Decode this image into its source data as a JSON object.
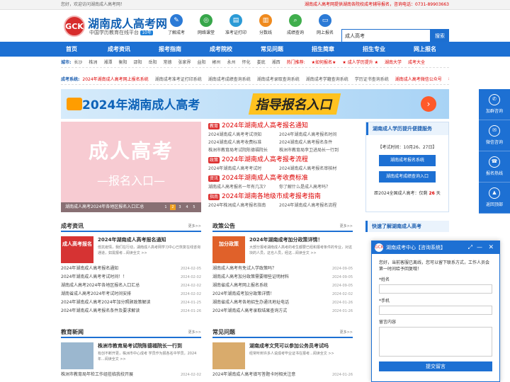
{
  "topbar": {
    "welcome": "您好，欢迎访问湖南成人高考网！",
    "notice": "湖南成人高考网提供湖南各院校成考辅导报名，咨询电话：0731-89903663"
  },
  "logo": {
    "mark": "GCK",
    "title": "湖南成人高考网",
    "subtitle": "中国学历教育在线平台",
    "badge": "10年"
  },
  "quick": [
    {
      "label": "了解成考",
      "icon": "book-icon",
      "color": "#2b7ad6"
    },
    {
      "label": "网络课堂",
      "icon": "globe-icon",
      "color": "#37a64a"
    },
    {
      "label": "准考证打印",
      "icon": "print-icon",
      "color": "#2b9ad6"
    },
    {
      "label": "分数线",
      "icon": "chart-icon",
      "color": "#ef8a1e"
    },
    {
      "label": "成绩查询",
      "icon": "search-icon",
      "color": "#40ae4d"
    },
    {
      "label": "网上报名",
      "icon": "monitor-icon",
      "color": "#2b7ad6"
    }
  ],
  "search": {
    "value": "成人高考",
    "button": "搜索"
  },
  "nav": [
    "首页",
    "成考资讯",
    "报考指南",
    "成考院校",
    "常见问题",
    "招生简章",
    "招生专业",
    "网上报名"
  ],
  "cities": {
    "label": "城市:",
    "items": [
      "长沙",
      "株洲",
      "湘潭",
      "衡阳",
      "邵阳",
      "岳阳",
      "常德",
      "张家界",
      "益阳",
      "郴州",
      "永州",
      "怀化",
      "娄底",
      "湘西"
    ],
    "hot": [
      "热门推荐:",
      "★如何报名★",
      "★ 成人学历提升 ★",
      "湖南大学",
      "成考大全"
    ]
  },
  "system": {
    "label": "成考系统:",
    "items": [
      "2024年湖南成人高考网上报名系统",
      "湖南成考准考证打印系统",
      "湖南成考成绩查询系统",
      "湖南成考录取查询系统",
      "湖南成考学籍查询系统",
      "学历证书查询系统",
      "湖南成人高考微信公众号",
      "考生交流群"
    ]
  },
  "banner": {
    "title": "2024年湖南成人高考",
    "highlight": "指导报名入口",
    "arrow": "›"
  },
  "slide": {
    "line1": "成人高考",
    "line2": "—报名入口—",
    "caption": "湖南成人高考2024年各地区报名入口汇总",
    "pages": [
      "1",
      "2",
      "3",
      "4",
      "5"
    ]
  },
  "news": [
    {
      "tag": "教育",
      "title": "2024年湖南成人高考报名通知",
      "items": [
        "2024湖南成人高考考试须知",
        "2024年湖南成人高考报名时间",
        "2024湖南成人高考收费标准",
        "2024湖南成人高考报名条件",
        "株洲市教育局考试院陈德福院长",
        "株洲市教育局李卫进局长一行到"
      ]
    },
    {
      "tag": "政策",
      "title": "2024年湖南成人高考报考流程",
      "items": [
        "2024年湖南成人高考考试时",
        "2024湖南成人高考报名审核材"
      ]
    },
    {
      "tag": "资讯",
      "title": "2024年湖南成人高考收费标准",
      "items": [
        "湖南成人高考报名一年有几次?",
        "你了解什么是成人高考吗？"
      ]
    },
    {
      "tag": "指南",
      "title": "2024年湖南各地级市成考报考指南",
      "items": [
        "2024年株洲成人高考报名指南",
        "2024年湖南成人高考报名流程"
      ]
    }
  ],
  "enroll": {
    "title": "湖南成人学历提升便捷服务",
    "dates": "【考试时间：10月26、27日】",
    "btn1": "湖南成考报名系统",
    "btn2": "湖南成考成绩查询入口",
    "countdown_pre": "距2024全国成人高考：仅剩",
    "days": "26",
    "countdown_post": "天"
  },
  "sec1": {
    "title": "成考资讯",
    "more": "更多>>",
    "img": "成人高考报名",
    "head": "2024年湖南成人高考报名通知",
    "summary": "低抗疫情，我们在行动，湖南成人高考网学习中心已恢复在线咨询通道，如需报考...阅读全文 >>",
    "items": [
      [
        "2024年湖南成人高考报名通知",
        "2024-02-05"
      ],
      [
        "2024年湖南成人高考考试时间！！",
        "2024-02-02"
      ],
      [
        "湖南成人高考2024年各地区报名入口汇总",
        "2024-02-02"
      ],
      [
        "湖南省成人高考2024年考试时间安排",
        "2024-02-02"
      ],
      [
        "2024年湖南成人高考2024年加分照顾政策解读",
        "2024-01-25"
      ],
      [
        "2024年湖南成人高考报名条件及要求解读",
        "2024-01-26"
      ]
    ]
  },
  "sec2": {
    "title": "政策公告",
    "more": "更多>>",
    "img": "加分政策",
    "head": "2024年湖南成考加分政策详情！",
    "summary": "大部分报考湖南成人高考的考生都要已经和报考条件的专业，对这块的人员，这也人员，经这...阅读全文 >>",
    "items": [
      [
        "湖南成人高考有免试入学政策吗？",
        "2024-09-05"
      ],
      [
        "湖南成人高考加分政策需要哪些证明材料",
        "2024-09-05"
      ],
      [
        "湖南省成人高考网上报名系统",
        "2024-09-05"
      ],
      [
        "2024年湖南成考加分政策详情！",
        "2024-02-02"
      ],
      [
        "湖南省成人高考各地招生办通讯地址电话",
        "2024-01-26"
      ],
      [
        "2024年湖南成人高考录取结果查询方式",
        "2024-01-26"
      ]
    ]
  },
  "quickfind": {
    "title": "快速了解湖南成人高考"
  },
  "sec3": {
    "title": "教育新闻",
    "more": "更多>>",
    "head": "株洲市教育局考试院陈德福院长一行到",
    "summary": "有创不断开更，株洲市中心成考 学员作为报各名中学员，2024年...阅读全文 >>",
    "item": "株洲市教育局年检工作组莅临我校开展",
    "date": "2024-02-02"
  },
  "sec4": {
    "title": "常见问题",
    "more": "更多>>",
    "head": "湖南成考文凭可以参加公务员考试吗",
    "summary": "经常听到许多人说成考毕业证书在报考...阅读全文 >>",
    "item": "2024年湖南成人高考填写答题卡时相关注意",
    "date": "2024-01-26"
  },
  "float": [
    {
      "label": "加群咨询",
      "icon": "group-icon",
      "glyph": "✆"
    },
    {
      "label": "微信咨询",
      "icon": "wechat-icon",
      "glyph": "✉"
    },
    {
      "label": "报名热线",
      "icon": "phone-icon",
      "glyph": "☎"
    },
    {
      "label": "返回顶部",
      "icon": "top-icon",
      "glyph": "▲"
    }
  ],
  "chat": {
    "title": "湖南成考中心【咨询系统】",
    "greeting": "您好，当前客服已离线，您可以留下联系方式，工作人员会第一时间给予回复哦！",
    "name": "*姓名",
    "phone": "*手机",
    "msg": "留言内容",
    "submit": "提交留言"
  }
}
